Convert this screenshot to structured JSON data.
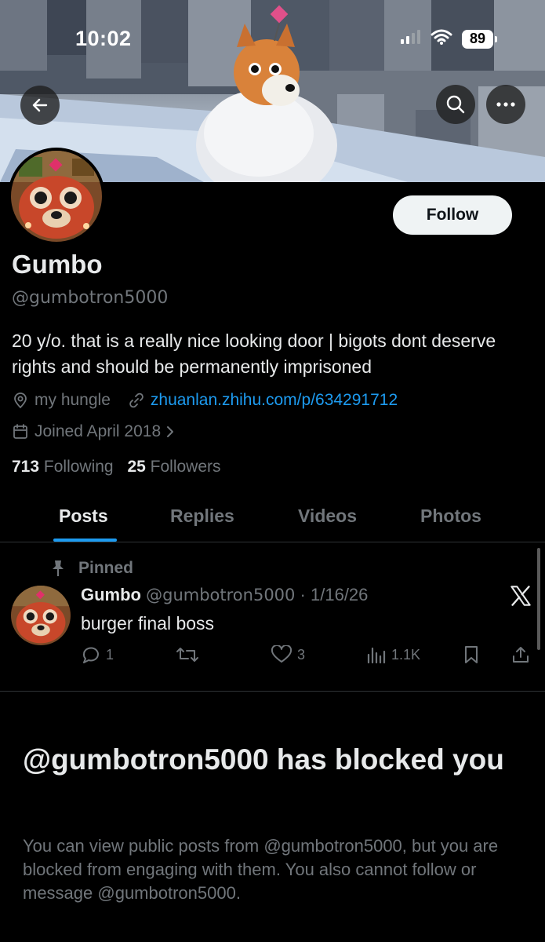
{
  "status_bar": {
    "time": "10:02",
    "battery": "89"
  },
  "header": {
    "back_icon": "arrow-left-icon",
    "search_icon": "search-icon",
    "more_icon": "more-horizontal-icon"
  },
  "profile": {
    "follow_label": "Follow",
    "name": "Gumbo",
    "handle": "@gumbotron5000",
    "bio": "20 y/o. that is a really nice looking door | bigots dont deserve rights and should be permanently imprisoned",
    "location": "my hungle",
    "website": "zhuanlan.zhihu.com/p/634291712",
    "joined": "Joined April 2018",
    "following_count": "713",
    "following_label": "Following",
    "followers_count": "25",
    "followers_label": "Followers"
  },
  "tabs": [
    {
      "label": "Posts",
      "active": true
    },
    {
      "label": "Replies",
      "active": false
    },
    {
      "label": "Videos",
      "active": false
    },
    {
      "label": "Photos",
      "active": false
    }
  ],
  "pinned_post": {
    "pinned_label": "Pinned",
    "author_name": "Gumbo",
    "author_handle": "@gumbotron5000",
    "separator": "·",
    "date": "1/16/26",
    "text": "burger final boss",
    "replies": "1",
    "reposts": "",
    "likes": "3",
    "views": "1.1K"
  },
  "blocked_notice": {
    "title": "@gumbotron5000 has blocked you",
    "description": "You can view public posts from @gumbotron5000, but you are blocked from engaging with them. You also cannot follow or message @gumbotron5000."
  },
  "colors": {
    "background": "#000000",
    "text_primary": "#e7e9ea",
    "text_secondary": "#71767b",
    "accent": "#1d9bf0",
    "follow_button_bg": "#eff3f4"
  }
}
